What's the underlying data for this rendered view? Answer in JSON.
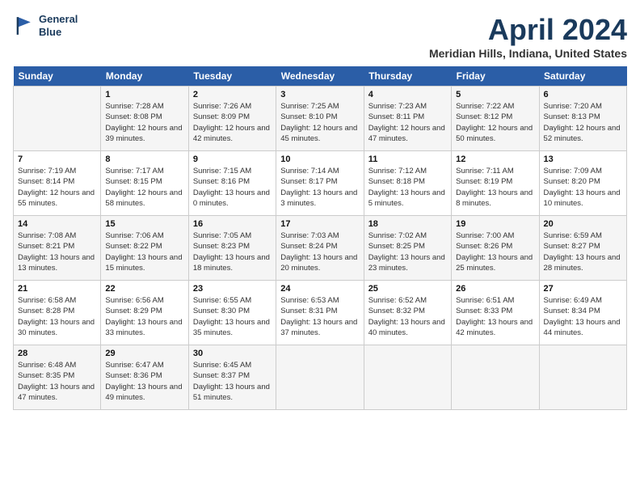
{
  "logo": {
    "line1": "General",
    "line2": "Blue"
  },
  "title": "April 2024",
  "subtitle": "Meridian Hills, Indiana, United States",
  "days_header": [
    "Sunday",
    "Monday",
    "Tuesday",
    "Wednesday",
    "Thursday",
    "Friday",
    "Saturday"
  ],
  "weeks": [
    [
      {
        "num": "",
        "sunrise": "",
        "sunset": "",
        "daylight": ""
      },
      {
        "num": "1",
        "sunrise": "Sunrise: 7:28 AM",
        "sunset": "Sunset: 8:08 PM",
        "daylight": "Daylight: 12 hours and 39 minutes."
      },
      {
        "num": "2",
        "sunrise": "Sunrise: 7:26 AM",
        "sunset": "Sunset: 8:09 PM",
        "daylight": "Daylight: 12 hours and 42 minutes."
      },
      {
        "num": "3",
        "sunrise": "Sunrise: 7:25 AM",
        "sunset": "Sunset: 8:10 PM",
        "daylight": "Daylight: 12 hours and 45 minutes."
      },
      {
        "num": "4",
        "sunrise": "Sunrise: 7:23 AM",
        "sunset": "Sunset: 8:11 PM",
        "daylight": "Daylight: 12 hours and 47 minutes."
      },
      {
        "num": "5",
        "sunrise": "Sunrise: 7:22 AM",
        "sunset": "Sunset: 8:12 PM",
        "daylight": "Daylight: 12 hours and 50 minutes."
      },
      {
        "num": "6",
        "sunrise": "Sunrise: 7:20 AM",
        "sunset": "Sunset: 8:13 PM",
        "daylight": "Daylight: 12 hours and 52 minutes."
      }
    ],
    [
      {
        "num": "7",
        "sunrise": "Sunrise: 7:19 AM",
        "sunset": "Sunset: 8:14 PM",
        "daylight": "Daylight: 12 hours and 55 minutes."
      },
      {
        "num": "8",
        "sunrise": "Sunrise: 7:17 AM",
        "sunset": "Sunset: 8:15 PM",
        "daylight": "Daylight: 12 hours and 58 minutes."
      },
      {
        "num": "9",
        "sunrise": "Sunrise: 7:15 AM",
        "sunset": "Sunset: 8:16 PM",
        "daylight": "Daylight: 13 hours and 0 minutes."
      },
      {
        "num": "10",
        "sunrise": "Sunrise: 7:14 AM",
        "sunset": "Sunset: 8:17 PM",
        "daylight": "Daylight: 13 hours and 3 minutes."
      },
      {
        "num": "11",
        "sunrise": "Sunrise: 7:12 AM",
        "sunset": "Sunset: 8:18 PM",
        "daylight": "Daylight: 13 hours and 5 minutes."
      },
      {
        "num": "12",
        "sunrise": "Sunrise: 7:11 AM",
        "sunset": "Sunset: 8:19 PM",
        "daylight": "Daylight: 13 hours and 8 minutes."
      },
      {
        "num": "13",
        "sunrise": "Sunrise: 7:09 AM",
        "sunset": "Sunset: 8:20 PM",
        "daylight": "Daylight: 13 hours and 10 minutes."
      }
    ],
    [
      {
        "num": "14",
        "sunrise": "Sunrise: 7:08 AM",
        "sunset": "Sunset: 8:21 PM",
        "daylight": "Daylight: 13 hours and 13 minutes."
      },
      {
        "num": "15",
        "sunrise": "Sunrise: 7:06 AM",
        "sunset": "Sunset: 8:22 PM",
        "daylight": "Daylight: 13 hours and 15 minutes."
      },
      {
        "num": "16",
        "sunrise": "Sunrise: 7:05 AM",
        "sunset": "Sunset: 8:23 PM",
        "daylight": "Daylight: 13 hours and 18 minutes."
      },
      {
        "num": "17",
        "sunrise": "Sunrise: 7:03 AM",
        "sunset": "Sunset: 8:24 PM",
        "daylight": "Daylight: 13 hours and 20 minutes."
      },
      {
        "num": "18",
        "sunrise": "Sunrise: 7:02 AM",
        "sunset": "Sunset: 8:25 PM",
        "daylight": "Daylight: 13 hours and 23 minutes."
      },
      {
        "num": "19",
        "sunrise": "Sunrise: 7:00 AM",
        "sunset": "Sunset: 8:26 PM",
        "daylight": "Daylight: 13 hours and 25 minutes."
      },
      {
        "num": "20",
        "sunrise": "Sunrise: 6:59 AM",
        "sunset": "Sunset: 8:27 PM",
        "daylight": "Daylight: 13 hours and 28 minutes."
      }
    ],
    [
      {
        "num": "21",
        "sunrise": "Sunrise: 6:58 AM",
        "sunset": "Sunset: 8:28 PM",
        "daylight": "Daylight: 13 hours and 30 minutes."
      },
      {
        "num": "22",
        "sunrise": "Sunrise: 6:56 AM",
        "sunset": "Sunset: 8:29 PM",
        "daylight": "Daylight: 13 hours and 33 minutes."
      },
      {
        "num": "23",
        "sunrise": "Sunrise: 6:55 AM",
        "sunset": "Sunset: 8:30 PM",
        "daylight": "Daylight: 13 hours and 35 minutes."
      },
      {
        "num": "24",
        "sunrise": "Sunrise: 6:53 AM",
        "sunset": "Sunset: 8:31 PM",
        "daylight": "Daylight: 13 hours and 37 minutes."
      },
      {
        "num": "25",
        "sunrise": "Sunrise: 6:52 AM",
        "sunset": "Sunset: 8:32 PM",
        "daylight": "Daylight: 13 hours and 40 minutes."
      },
      {
        "num": "26",
        "sunrise": "Sunrise: 6:51 AM",
        "sunset": "Sunset: 8:33 PM",
        "daylight": "Daylight: 13 hours and 42 minutes."
      },
      {
        "num": "27",
        "sunrise": "Sunrise: 6:49 AM",
        "sunset": "Sunset: 8:34 PM",
        "daylight": "Daylight: 13 hours and 44 minutes."
      }
    ],
    [
      {
        "num": "28",
        "sunrise": "Sunrise: 6:48 AM",
        "sunset": "Sunset: 8:35 PM",
        "daylight": "Daylight: 13 hours and 47 minutes."
      },
      {
        "num": "29",
        "sunrise": "Sunrise: 6:47 AM",
        "sunset": "Sunset: 8:36 PM",
        "daylight": "Daylight: 13 hours and 49 minutes."
      },
      {
        "num": "30",
        "sunrise": "Sunrise: 6:45 AM",
        "sunset": "Sunset: 8:37 PM",
        "daylight": "Daylight: 13 hours and 51 minutes."
      },
      {
        "num": "",
        "sunrise": "",
        "sunset": "",
        "daylight": ""
      },
      {
        "num": "",
        "sunrise": "",
        "sunset": "",
        "daylight": ""
      },
      {
        "num": "",
        "sunrise": "",
        "sunset": "",
        "daylight": ""
      },
      {
        "num": "",
        "sunrise": "",
        "sunset": "",
        "daylight": ""
      }
    ]
  ]
}
